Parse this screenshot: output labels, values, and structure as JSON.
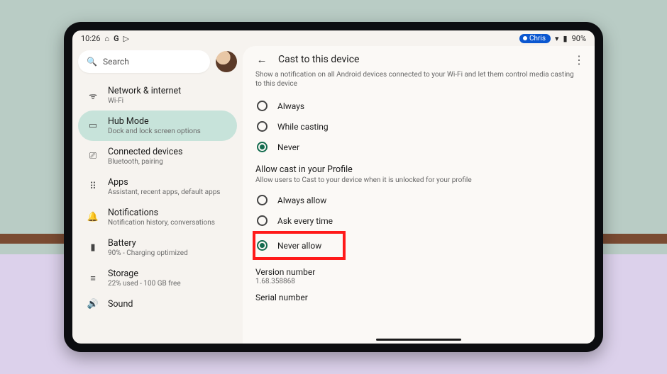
{
  "status": {
    "time": "10:26",
    "home_icon": "⌂",
    "g_icon": "G",
    "play_icon": "▷",
    "user_pill": "Chris",
    "wifi_icon": "▾",
    "battery_icon": "▮",
    "battery_pct": "90%"
  },
  "search": {
    "placeholder": "Search",
    "icon": "🔍"
  },
  "sidebar": [
    {
      "icon": "ᯤ",
      "title": "Network & internet",
      "sub": "Wi-Fi",
      "selected": false
    },
    {
      "icon": "▭",
      "title": "Hub Mode",
      "sub": "Dock and lock screen options",
      "selected": true
    },
    {
      "icon": "⎚",
      "title": "Connected devices",
      "sub": "Bluetooth, pairing",
      "selected": false
    },
    {
      "icon": "⠿",
      "title": "Apps",
      "sub": "Assistant, recent apps, default apps",
      "selected": false
    },
    {
      "icon": "🔔",
      "title": "Notifications",
      "sub": "Notification history, conversations",
      "selected": false
    },
    {
      "icon": "▮",
      "title": "Battery",
      "sub": "90% - Charging optimized",
      "selected": false
    },
    {
      "icon": "≡",
      "title": "Storage",
      "sub": "22% used - 100 GB free",
      "selected": false
    },
    {
      "icon": "🔊",
      "title": "Sound",
      "sub": "",
      "selected": false
    }
  ],
  "page": {
    "back_icon": "←",
    "title": "Cast to this device",
    "subtitle": "Show a notification on all Android devices connected to your Wi-Fi and let them control media casting to this device",
    "group1": [
      {
        "label": "Always",
        "selected": false
      },
      {
        "label": "While casting",
        "selected": false
      },
      {
        "label": "Never",
        "selected": true
      }
    ],
    "section2_title": "Allow cast in your Profile",
    "section2_sub": "Allow users to Cast to your device when it is unlocked for your profile",
    "group2": [
      {
        "label": "Always allow",
        "selected": false
      },
      {
        "label": "Ask every time",
        "selected": false
      },
      {
        "label": "Never allow",
        "selected": true,
        "highlighted": true
      }
    ],
    "version_label": "Version number",
    "version_value": "1.68.358868",
    "serial_label": "Serial number",
    "kebab_icon": "⋮"
  }
}
